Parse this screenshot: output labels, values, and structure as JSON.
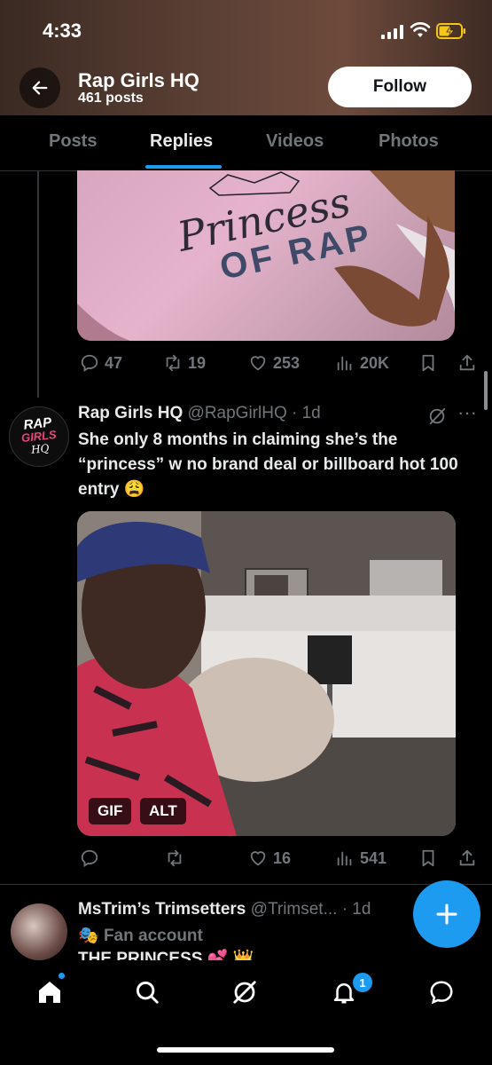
{
  "status_bar": {
    "time": "4:33"
  },
  "profile_header": {
    "title": "Rap Girls HQ",
    "posts_count": "461 posts",
    "follow_label": "Follow"
  },
  "tabs": [
    {
      "label": "Posts"
    },
    {
      "label": "Replies"
    },
    {
      "label": "Videos"
    },
    {
      "label": "Photos"
    }
  ],
  "post1": {
    "shirt_text_1": "Princess",
    "shirt_text_2": "OF RAP",
    "replies": "47",
    "reposts": "19",
    "likes": "253",
    "views": "20K"
  },
  "post2": {
    "avatar_text_1": "RAP",
    "avatar_text_2": "GIRLS",
    "avatar_text_3": "HQ",
    "author": "Rap Girls HQ",
    "handle": "@RapGirlHQ · 1d",
    "text": "She only 8 months in claiming she’s the “princess” w no brand deal or billboard hot 100 entry 😩",
    "media_badges": {
      "gif": "GIF",
      "alt": "ALT"
    },
    "replies": "",
    "reposts": "",
    "likes": "16",
    "views": "541"
  },
  "post3": {
    "author": "MsTrim’s Trimsetters",
    "handle": "@Trimset... · 1d",
    "label": "Fan account",
    "text": "THE PRINCESS 💕 👑"
  },
  "bottom_nav": {
    "notifications_count": "1"
  },
  "colors": {
    "accent": "#1d9bf0",
    "background": "#000000",
    "muted": "#71767b"
  }
}
